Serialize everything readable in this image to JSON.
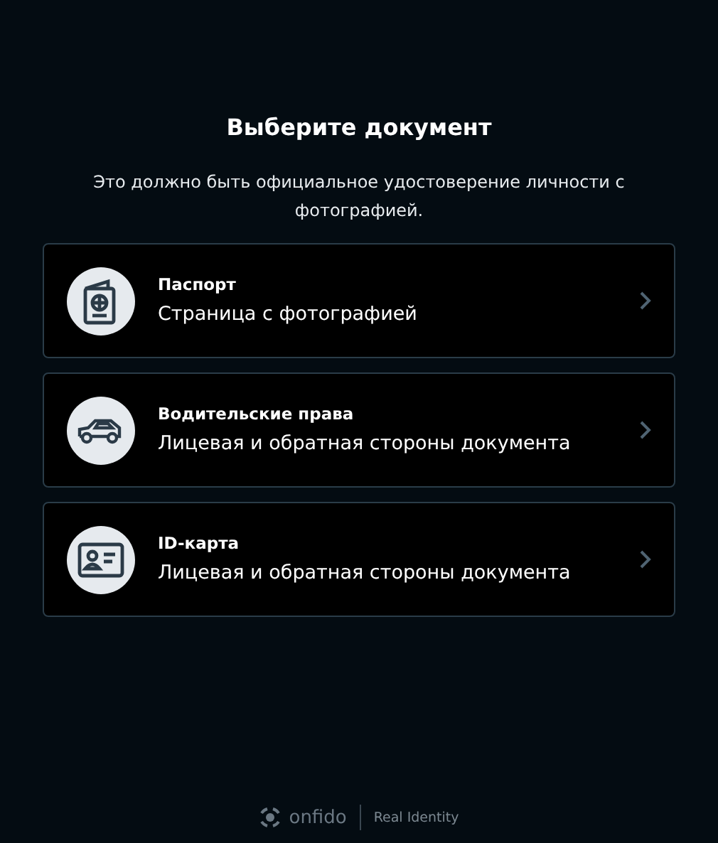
{
  "title": "Выберите документ",
  "subtitle": "Это должно быть официальное удостоверение личности с фотографией.",
  "documents": [
    {
      "kind": "passport",
      "name": "Паспорт",
      "description": "Страница с фотографией"
    },
    {
      "kind": "car",
      "name": "Водительские права",
      "description": "Лицевая и обратная стороны документа"
    },
    {
      "kind": "card",
      "name": "ID-карта",
      "description": "Лицевая и обратная стороны документа"
    }
  ],
  "footer": {
    "brand": "onfido",
    "tagline": "Real Identity"
  }
}
